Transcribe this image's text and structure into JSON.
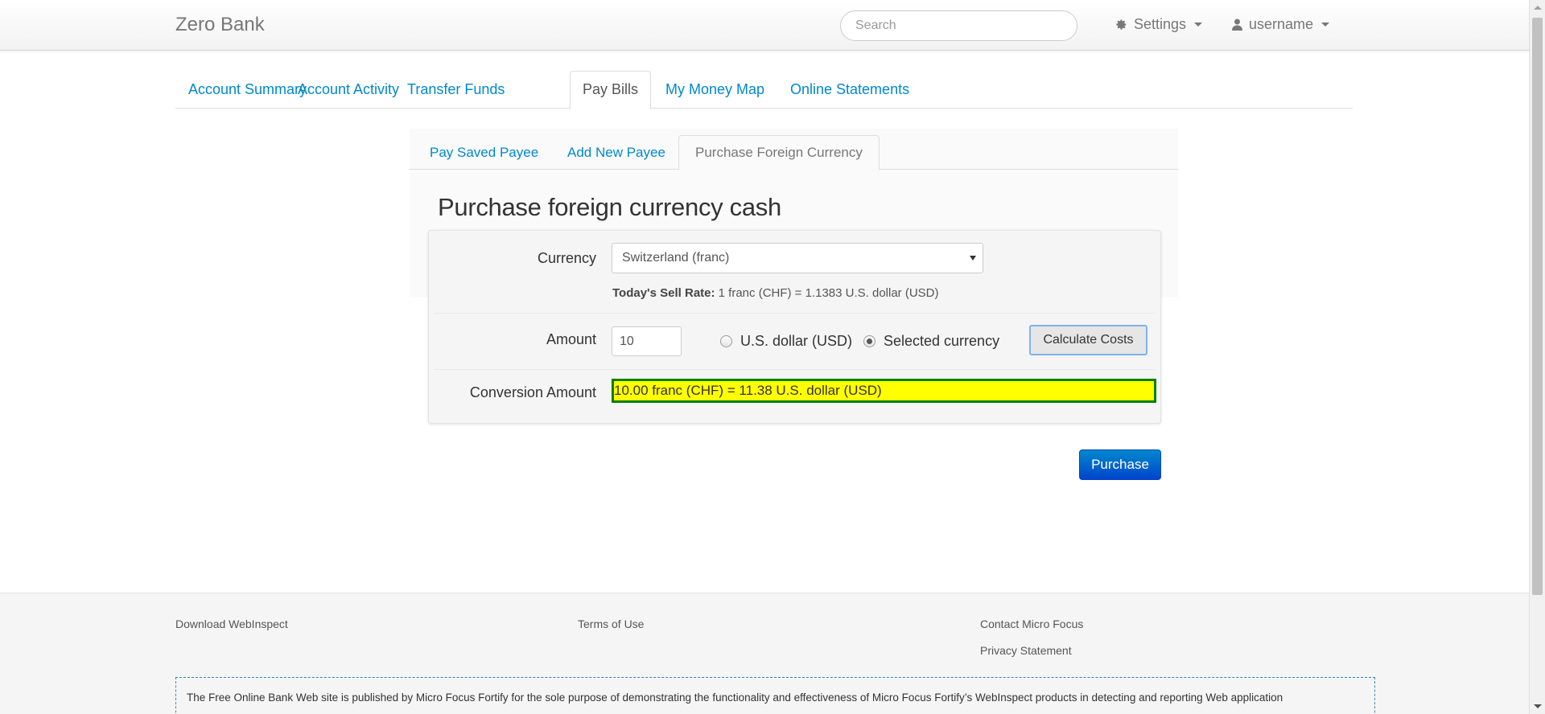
{
  "navbar": {
    "brand": "Zero Bank",
    "search_placeholder": "Search",
    "settings_label": "Settings",
    "user_label": "username"
  },
  "main_tabs": [
    {
      "label": "Account Summary"
    },
    {
      "label": "Account Activity"
    },
    {
      "label": "Transfer Funds"
    },
    {
      "label": "Pay Bills",
      "active": true
    },
    {
      "label": "My Money Map"
    },
    {
      "label": "Online Statements"
    }
  ],
  "sub_tabs": [
    {
      "label": "Pay Saved Payee"
    },
    {
      "label": "Add New Payee"
    },
    {
      "label": "Purchase Foreign Currency",
      "active": true
    }
  ],
  "form": {
    "heading": "Purchase foreign currency cash",
    "currency_label": "Currency",
    "currency_value": "Switzerland (franc)",
    "sell_rate_label": "Today's Sell Rate:",
    "sell_rate_text": "1 franc (CHF) = 1.1383 U.S. dollar (USD)",
    "amount_label": "Amount",
    "amount_value": "10",
    "radio_usd_label": "U.S. dollar (USD)",
    "radio_selected_label": "Selected currency",
    "selected_option": "Selected currency",
    "calculate_button": "Calculate Costs",
    "conversion_label": "Conversion Amount",
    "conversion_value": "10.00 franc (CHF) = 11.38 U.S. dollar (USD)",
    "purchase_button": "Purchase"
  },
  "footer": {
    "download": "Download WebInspect",
    "terms": "Terms of Use",
    "contact": "Contact Micro Focus",
    "privacy": "Privacy Statement",
    "disclaimer": "The Free Online Bank Web site is published by Micro Focus Fortify for the sole purpose of demonstrating the functionality and effectiveness of Micro Focus Fortify’s WebInspect products in detecting and reporting Web application"
  },
  "colors": {
    "link": "#0088cc",
    "highlight_bg": "#ffff00",
    "highlight_border": "#008000",
    "primary_button": "#0044cc"
  }
}
